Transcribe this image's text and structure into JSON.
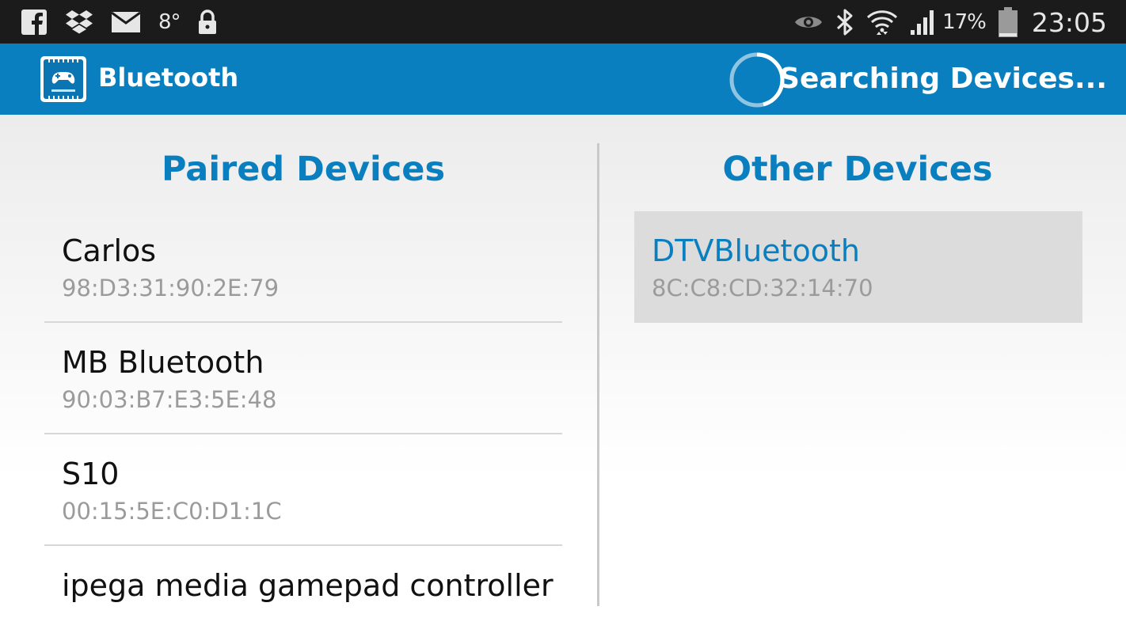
{
  "status_bar": {
    "left_icons": [
      "facebook-icon",
      "dropbox-icon",
      "mail-icon",
      "weather-icon",
      "lock-icon"
    ],
    "temperature": "8°",
    "right_icons": [
      "eye-icon",
      "bluetooth-icon",
      "wifi-icon",
      "signal-icon",
      "battery-icon"
    ],
    "battery_percent": "17%",
    "time": "23:05"
  },
  "action_bar": {
    "title": "Bluetooth",
    "status_text": "Searching Devices...",
    "colors": {
      "bar": "#0a7fbf",
      "text": "#ffffff"
    }
  },
  "paired": {
    "title": "Paired Devices",
    "devices": [
      {
        "name": "Carlos",
        "address": "98:D3:31:90:2E:79"
      },
      {
        "name": "MB Bluetooth",
        "address": "90:03:B7:E3:5E:48"
      },
      {
        "name": "S10",
        "address": "00:15:5E:C0:D1:1C"
      },
      {
        "name": "ipega media gamepad controller",
        "address": ""
      }
    ]
  },
  "other": {
    "title": "Other Devices",
    "devices": [
      {
        "name": "DTVBluetooth",
        "address": "8C:C8:CD:32:14:70"
      }
    ]
  },
  "colors": {
    "accent": "#0a7fbf",
    "selected_bg": "#dcdcdc",
    "secondary_text": "#9b9b9b"
  }
}
